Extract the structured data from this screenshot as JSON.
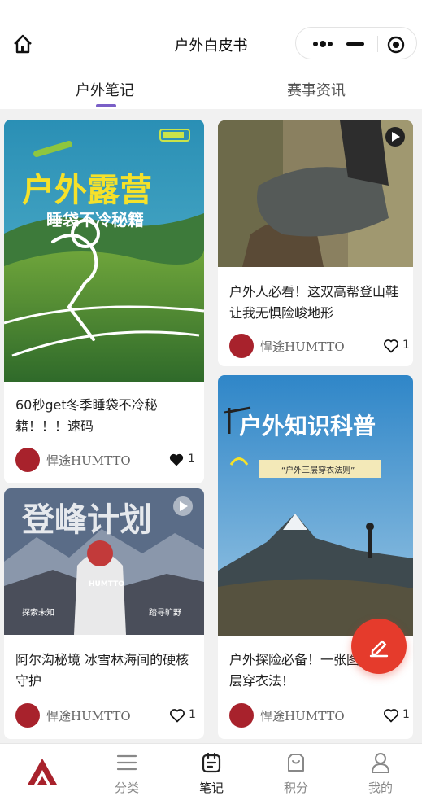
{
  "header": {
    "title": "户外白皮书"
  },
  "tabs": [
    {
      "label": "户外笔记",
      "active": true
    },
    {
      "label": "赛事资讯",
      "active": false
    }
  ],
  "cards": [
    {
      "image_title": "户外露营",
      "image_subtitle": "睡袋不冷秘籍",
      "caption": "60秒get冬季睡袋不冷秘籍！！！速码",
      "author": "悍途HUMTTO",
      "likes": "1",
      "liked": true
    },
    {
      "caption": "户外人必看！这双高帮登山鞋让我无惧险峻地形",
      "author": "悍途HUMTTO",
      "likes": "1",
      "liked": false
    },
    {
      "image_title": "登峰计划",
      "image_left_text": "探索未知",
      "image_right_text": "踏寻旷野",
      "image_brand": "HUMTTO",
      "caption": "阿尔沟秘境 冰雪林海间的硬核守护",
      "author": "悍途HUMTTO",
      "likes": "1",
      "liked": false
    },
    {
      "image_title": "户外知识科普",
      "image_subtitle": "“户外三层穿衣法则”",
      "caption": "户外探险必备！一张图看懂三层穿衣法！",
      "author": "悍途HUMTTO",
      "likes": "1",
      "liked": false
    }
  ],
  "bottom_nav": [
    {
      "label": "",
      "icon": "brand-logo-icon"
    },
    {
      "label": "分类",
      "icon": "menu-icon"
    },
    {
      "label": "笔记",
      "icon": "notes-icon",
      "active": true
    },
    {
      "label": "积分",
      "icon": "points-icon"
    },
    {
      "label": "我的",
      "icon": "user-icon"
    }
  ],
  "colors": {
    "accent": "#7a5fc7",
    "fab": "#e53b2c",
    "brand": "#a8222c"
  }
}
